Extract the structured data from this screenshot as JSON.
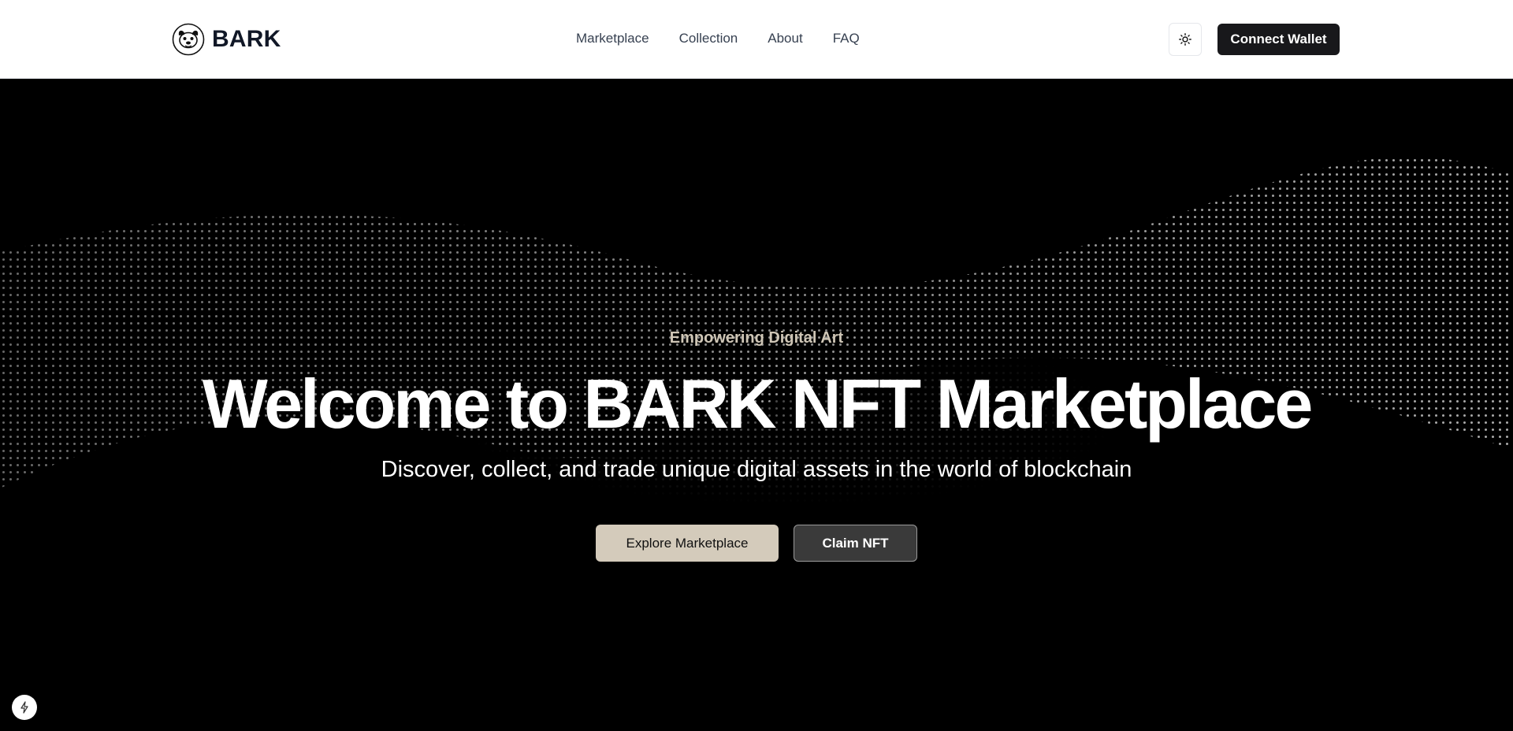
{
  "header": {
    "brand_name": "BARK",
    "brand_logo_icon": "dog-face-logo",
    "nav": [
      {
        "label": "Marketplace"
      },
      {
        "label": "Collection"
      },
      {
        "label": "About"
      },
      {
        "label": "FAQ"
      }
    ],
    "theme_toggle_icon": "sun-icon",
    "connect_label": "Connect Wallet"
  },
  "hero": {
    "eyebrow": "Empowering Digital Art",
    "title": "Welcome to BARK NFT Marketplace",
    "subtitle": "Discover, collect, and trade unique digital assets in the world of blockchain",
    "primary_cta": "Explore Marketplace",
    "secondary_cta": "Claim NFT"
  },
  "badge": {
    "icon": "lightning-icon"
  },
  "colors": {
    "header_bg": "#ffffff",
    "hero_bg": "#000000",
    "accent": "#d4cbbb",
    "eyebrow": "#cfc6b6",
    "dark_button": "#18181b"
  }
}
